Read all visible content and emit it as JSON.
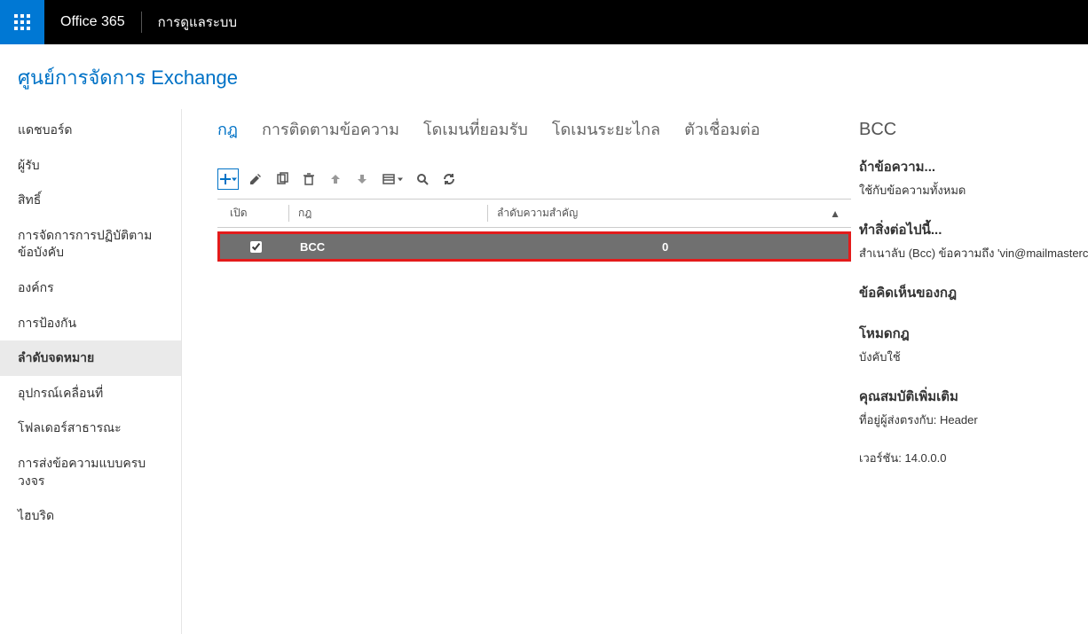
{
  "topbar": {
    "brand": "Office 365",
    "app": "การดูแลระบบ"
  },
  "page_title": "ศูนย์การจัดการ Exchange",
  "leftnav": [
    {
      "label": "แดชบอร์ด",
      "active": false
    },
    {
      "label": "ผู้รับ",
      "active": false
    },
    {
      "label": "สิทธิ์",
      "active": false
    },
    {
      "label": "การจัดการการปฏิบัติตามข้อบังคับ",
      "active": false
    },
    {
      "label": "องค์กร",
      "active": false
    },
    {
      "label": "การป้องกัน",
      "active": false
    },
    {
      "label": "ลำดับจดหมาย",
      "active": true
    },
    {
      "label": "อุปกรณ์เคลื่อนที่",
      "active": false
    },
    {
      "label": "โฟลเดอร์สาธารณะ",
      "active": false
    },
    {
      "label": "การส่งข้อความแบบครบวงจร",
      "active": false
    },
    {
      "label": "ไฮบริด",
      "active": false
    }
  ],
  "tabs": [
    {
      "label": "กฎ",
      "active": true
    },
    {
      "label": "การติดตามข้อความ",
      "active": false
    },
    {
      "label": "โดเมนที่ยอมรับ",
      "active": false
    },
    {
      "label": "โดเมนระยะไกล",
      "active": false
    },
    {
      "label": "ตัวเชื่อมต่อ",
      "active": false
    }
  ],
  "table": {
    "headers": {
      "on": "เปิด",
      "rule": "กฎ",
      "priority": "ลำดับความสำคัญ"
    },
    "rows": [
      {
        "on": true,
        "rule": "BCC",
        "priority": "0"
      }
    ]
  },
  "details": {
    "title": "BCC",
    "sections": [
      {
        "heading": "ถ้าข้อความ...",
        "value": "ใช้กับข้อความทั้งหมด"
      },
      {
        "heading": "ทำสิ่งต่อไปนี้...",
        "value": "สำเนาลับ (Bcc) ข้อความถึง 'vin@mailmasterco.onm"
      },
      {
        "heading": "ข้อคิดเห็นของกฎ",
        "value": ""
      },
      {
        "heading": "โหมดกฎ",
        "value": "บังคับใช้"
      },
      {
        "heading": "คุณสมบัติเพิ่มเติม",
        "value": "ที่อยู่ผู้ส่งตรงกับ: Header"
      }
    ],
    "version_label": "เวอร์ชัน:",
    "version_value": "14.0.0.0"
  }
}
